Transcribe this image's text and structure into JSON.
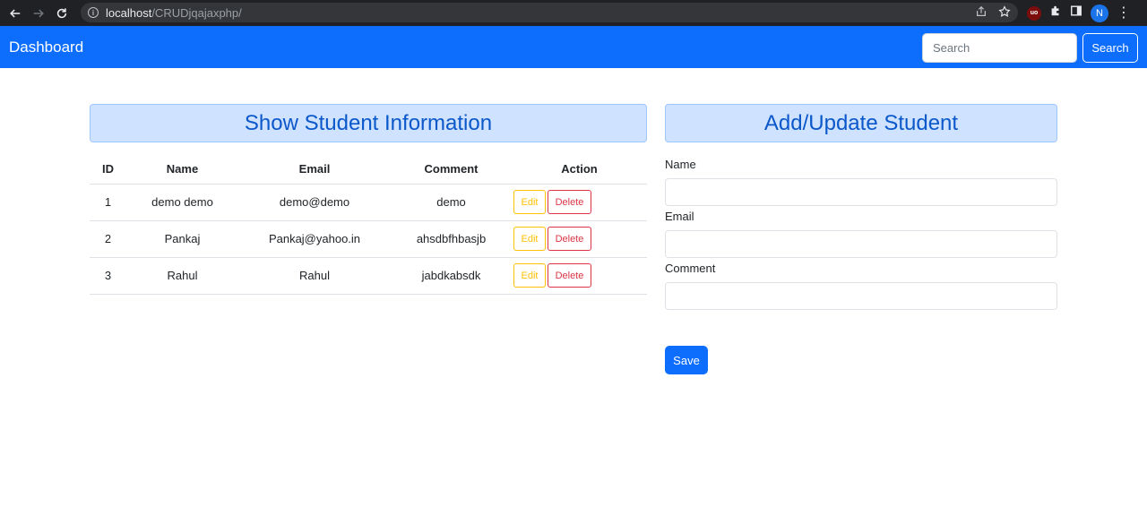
{
  "browser": {
    "url_host": "localhost",
    "url_path": "/CRUDjqajaxphp/",
    "profile_initial": "N",
    "extension_badge": "uo"
  },
  "navbar": {
    "brand": "Dashboard",
    "search_placeholder": "Search",
    "search_button": "Search"
  },
  "student_list": {
    "title": "Show Student Information",
    "columns": [
      "ID",
      "Name",
      "Email",
      "Comment",
      "Action"
    ],
    "rows": [
      {
        "id": "1",
        "name": "demo demo",
        "email": "demo@demo",
        "comment": "demo"
      },
      {
        "id": "2",
        "name": "Pankaj",
        "email": "Pankaj@yahoo.in",
        "comment": "ahsdbfhbasjb"
      },
      {
        "id": "3",
        "name": "Rahul",
        "email": "Rahul",
        "comment": "jabdkabsdk"
      }
    ],
    "edit_label": "Edit",
    "delete_label": "Delete"
  },
  "student_form": {
    "title": "Add/Update Student",
    "name_label": "Name",
    "name_value": "",
    "email_label": "Email",
    "email_value": "",
    "comment_label": "Comment",
    "comment_value": "",
    "save_label": "Save"
  },
  "colors": {
    "primary": "#0d6efd",
    "panel_bg": "#cfe2ff",
    "panel_text": "#0a58ca",
    "warning": "#ffc107",
    "danger": "#dc3545"
  }
}
